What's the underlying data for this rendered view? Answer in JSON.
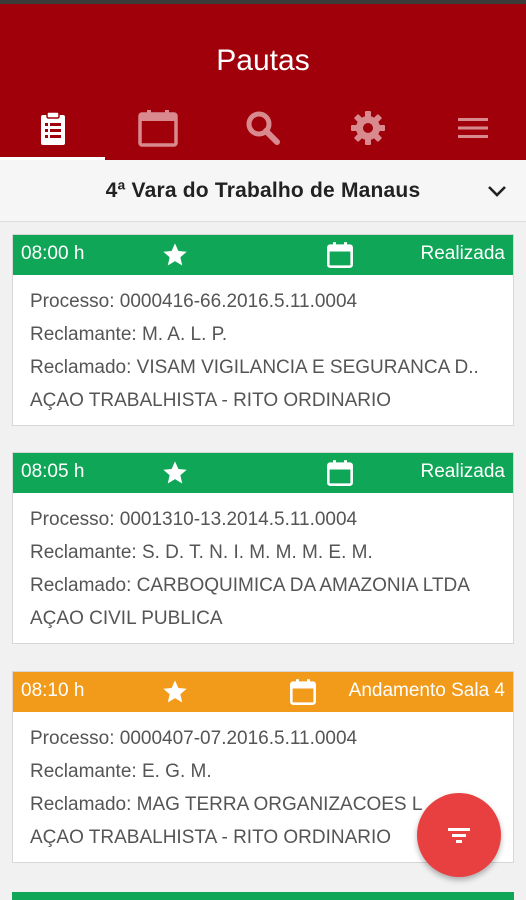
{
  "app": {
    "title": "Pautas"
  },
  "tabs": [
    {
      "name": "clipboard-icon"
    },
    {
      "name": "calendar-icon"
    },
    {
      "name": "search-icon"
    },
    {
      "name": "gear-icon"
    },
    {
      "name": "menu-icon"
    }
  ],
  "selector": {
    "label": "4ª Vara do Trabalho de Manaus"
  },
  "colors": {
    "primary": "#a0000a",
    "realizada": "#0fa757",
    "andamento": "#f29a1a",
    "fab": "#e84040"
  },
  "cards": [
    {
      "time": "08:00 h",
      "status": "Realizada",
      "processo": "Processo: 0000416-66.2016.5.11.0004",
      "reclamante": "Reclamante: M. A. L. P.",
      "reclamado": "Reclamado: VISAM VIGILANCIA E SEGURANCA D..",
      "acao": "AÇAO TRABALHISTA - RITO ORDINARIO"
    },
    {
      "time": "08:05 h",
      "status": "Realizada",
      "processo": "Processo: 0001310-13.2014.5.11.0004",
      "reclamante": "Reclamante: S. D. T. N. I. M. M. M. E. M.",
      "reclamado": "Reclamado: CARBOQUIMICA DA AMAZONIA LTDA",
      "acao": "AÇAO CIVIL PUBLICA"
    },
    {
      "time": "08:10 h",
      "status": "Andamento Sala 4",
      "processo": "Processo: 0000407-07.2016.5.11.0004",
      "reclamante": "Reclamante: E. G. M.",
      "reclamado": "Reclamado: MAG TERRA ORGANIZACOES L",
      "acao": "AÇAO TRABALHISTA - RITO ORDINARIO"
    }
  ]
}
